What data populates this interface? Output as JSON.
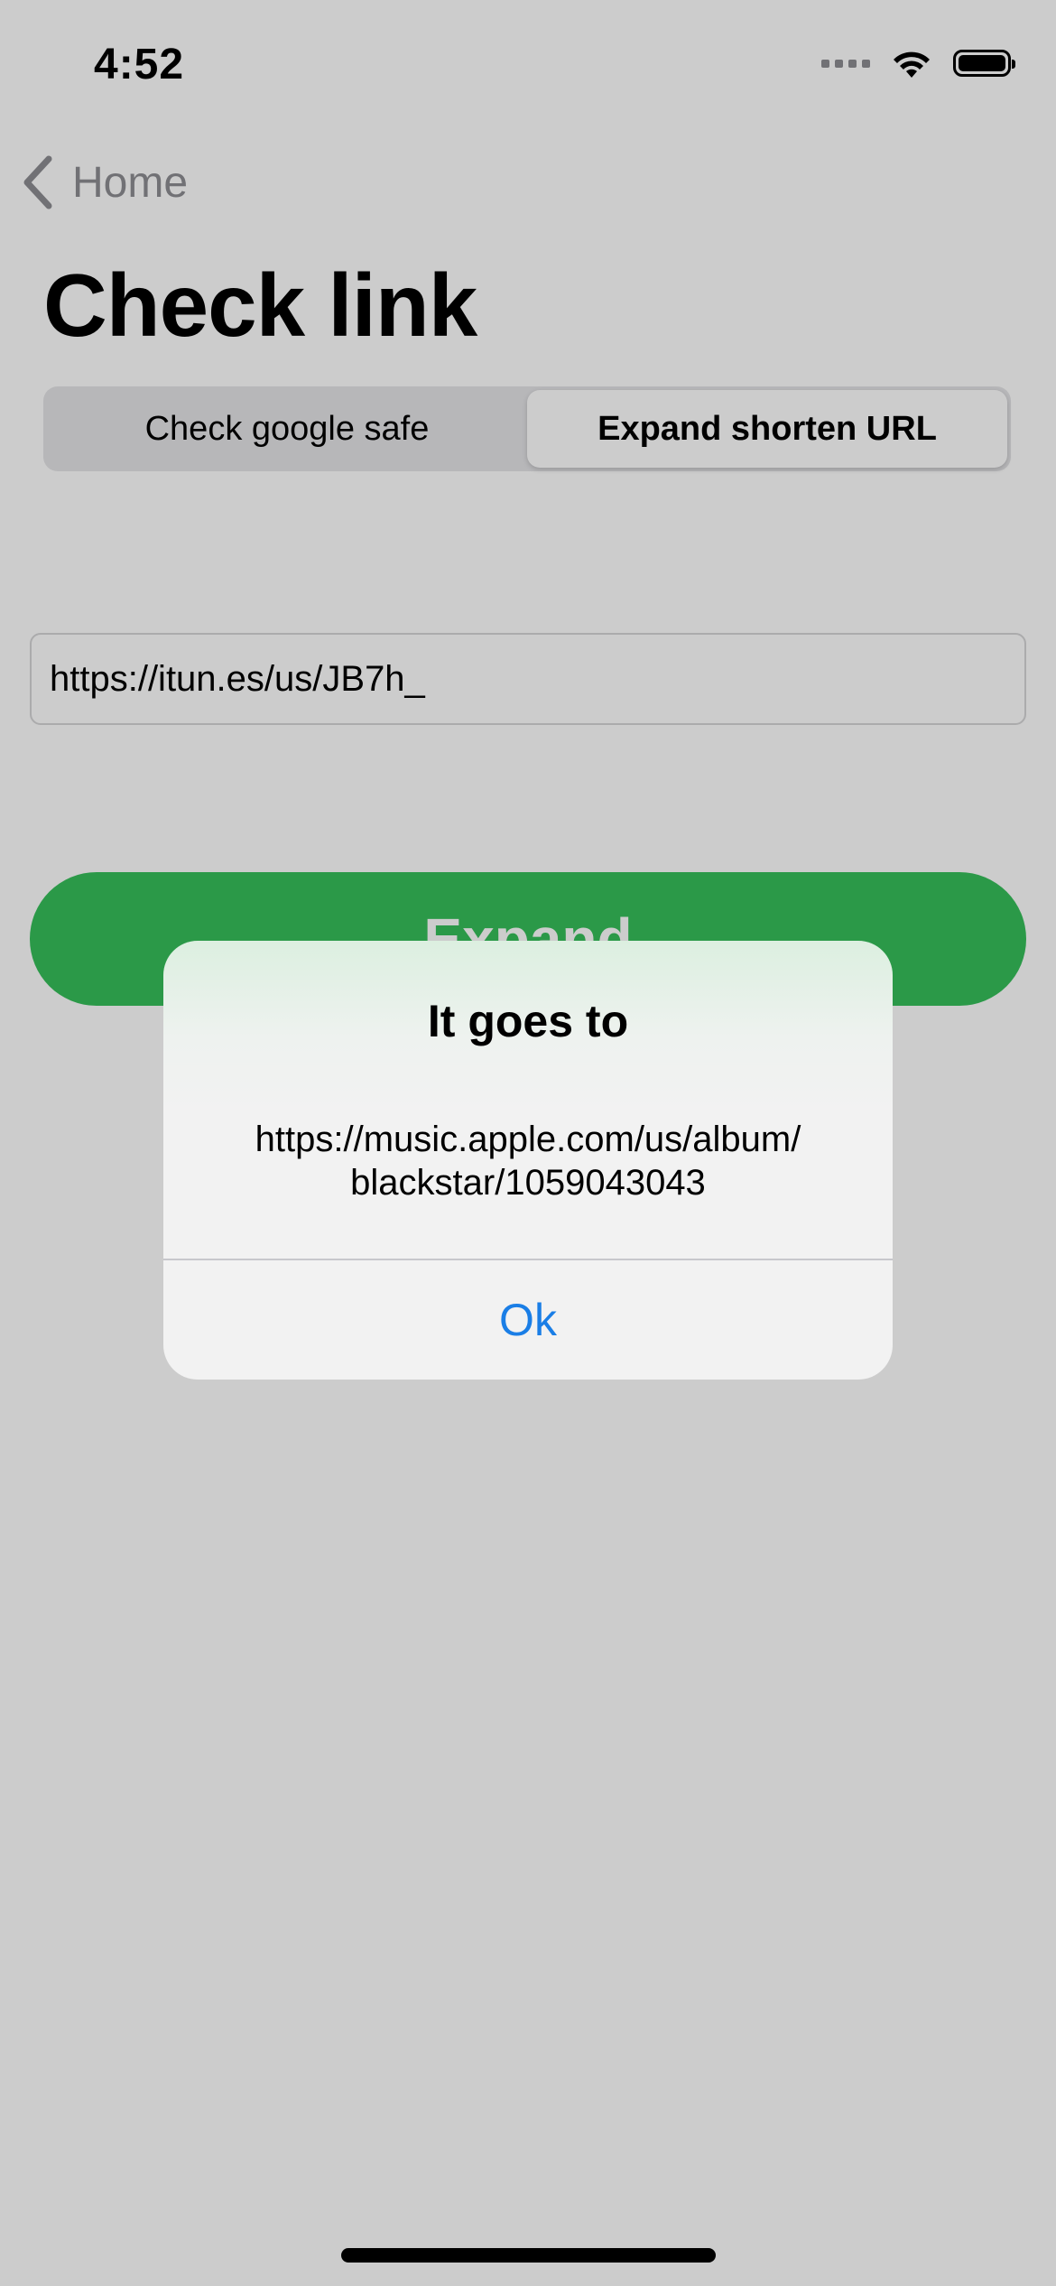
{
  "status_bar": {
    "time": "4:52",
    "icons": [
      "signal-dots-icon",
      "wifi-icon",
      "battery-icon"
    ]
  },
  "nav": {
    "back_label": "Home",
    "back_icon": "chevron-left-icon"
  },
  "page": {
    "title": "Check link"
  },
  "segmented": {
    "options": [
      {
        "label": "Check google safe",
        "selected": false
      },
      {
        "label": "Expand shorten URL",
        "selected": true
      }
    ]
  },
  "url_input": {
    "value": "https://itun.es/us/JB7h_"
  },
  "expand_button": {
    "label": "Expand"
  },
  "alert": {
    "title": "It goes to",
    "message_line1": "https://music.apple.com/us/album/",
    "message_line2": "blackstar/1059043043",
    "ok_label": "Ok"
  },
  "colors": {
    "accent_green": "#36c05a",
    "link_blue": "#1a7ee6",
    "dim_overlay": "rgba(0,0,0,0.2)"
  }
}
